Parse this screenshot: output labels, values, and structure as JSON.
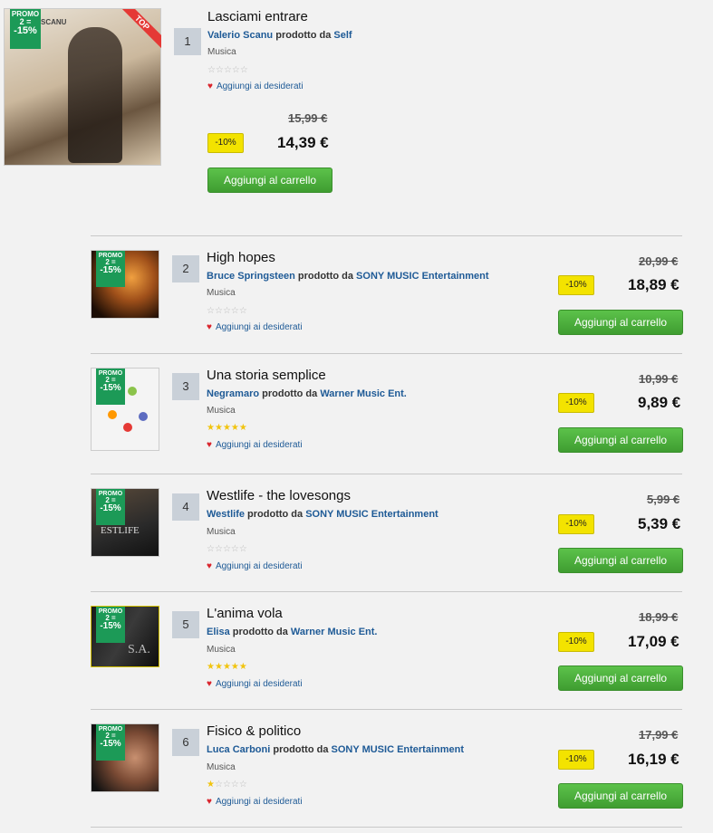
{
  "labels": {
    "by_connector": "prodotto da",
    "category": "Musica",
    "wishlist": "Aggiungi ai desiderati",
    "add_to_cart": "Aggiungi al carrello",
    "discount": "-10%",
    "promo_line1": "PROMO",
    "promo_line2": "2 =",
    "promo_line3": "-15%",
    "top_ribbon": "TOP"
  },
  "products": [
    {
      "rank": "1",
      "title": "Lasciami entrare",
      "artist": "Valerio Scanu",
      "label": "Self",
      "rating": 0,
      "old_price": "15,99 €",
      "new_price": "14,39 €"
    },
    {
      "rank": "2",
      "title": "High hopes",
      "artist": "Bruce Springsteen",
      "label": "SONY MUSIC Entertainment",
      "rating": 0,
      "old_price": "20,99 €",
      "new_price": "18,89 €"
    },
    {
      "rank": "3",
      "title": "Una storia semplice",
      "artist": "Negramaro",
      "label": "Warner Music Ent.",
      "rating": 5,
      "old_price": "10,99 €",
      "new_price": "9,89 €"
    },
    {
      "rank": "4",
      "title": "Westlife - the lovesongs",
      "artist": "Westlife",
      "label": "SONY MUSIC Entertainment",
      "rating": 0,
      "old_price": "5,99 €",
      "new_price": "5,39 €"
    },
    {
      "rank": "5",
      "title": "L'anima vola",
      "artist": "Elisa",
      "label": "Warner Music Ent.",
      "rating": 5,
      "old_price": "18,99 €",
      "new_price": "17,09 €"
    },
    {
      "rank": "6",
      "title": "Fisico & politico",
      "artist": "Luca Carboni",
      "label": "SONY MUSIC Entertainment",
      "rating": 1,
      "old_price": "17,99 €",
      "new_price": "16,19 €"
    }
  ],
  "colors": {
    "accent_green": "#4cb03c",
    "promo_green": "#1c9a57",
    "badge_yellow": "#f3e300",
    "link_blue": "#1e5a96",
    "star": "#f1c40f"
  }
}
